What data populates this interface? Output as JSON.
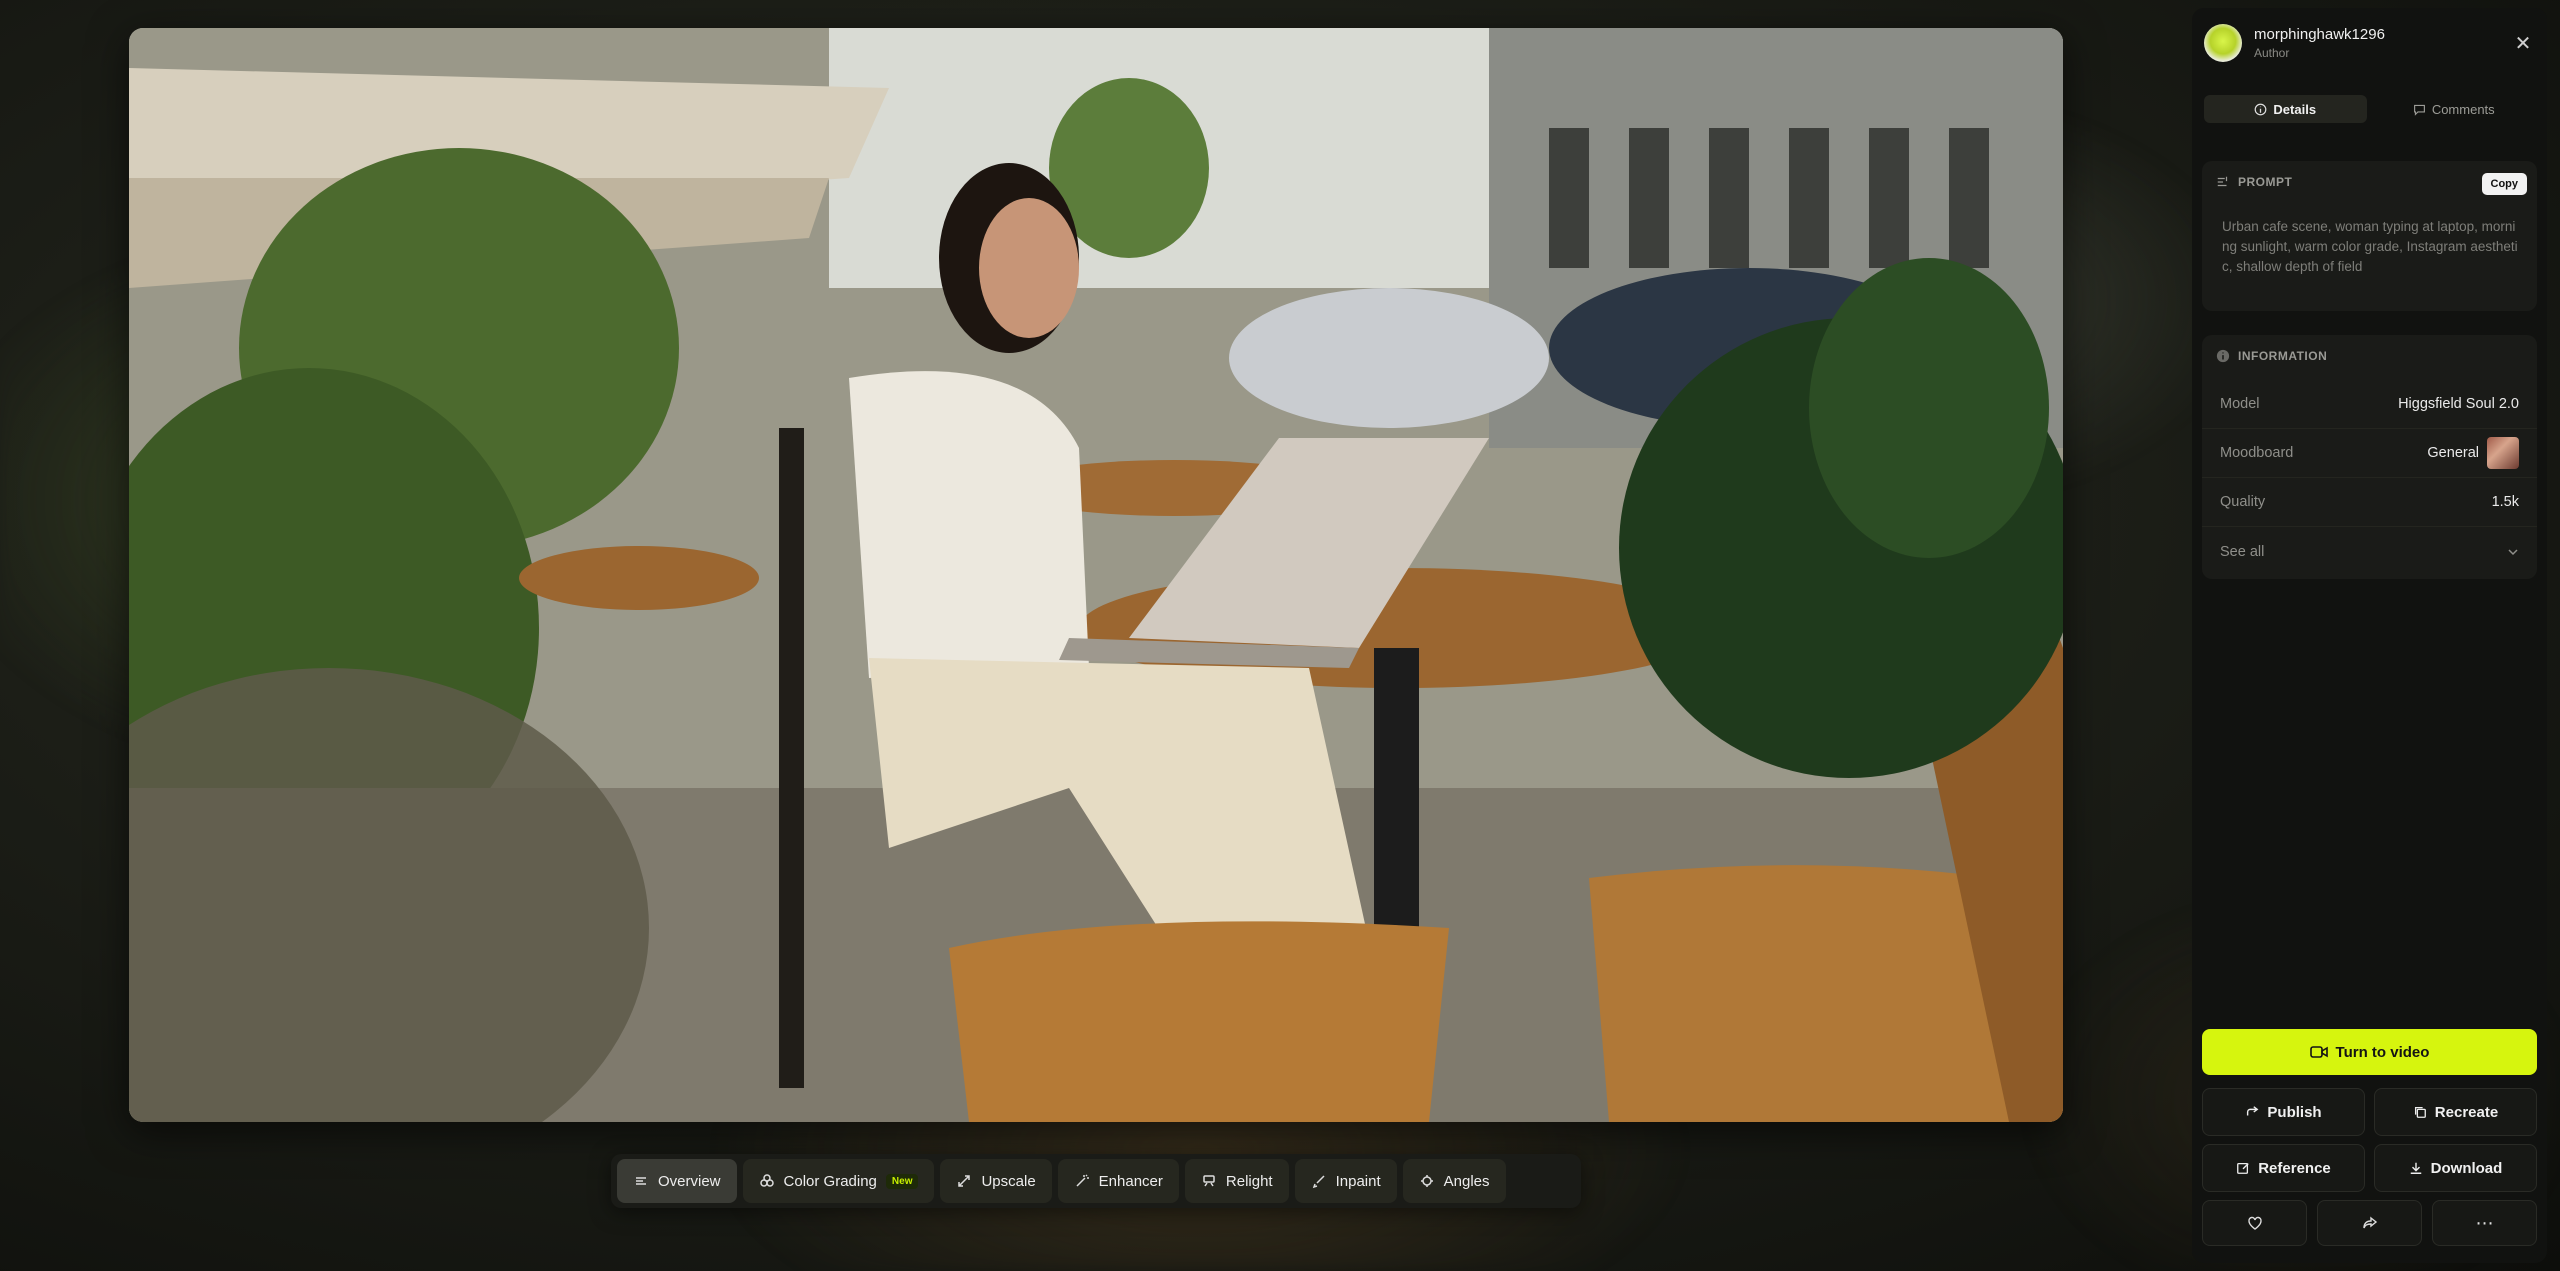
{
  "author": {
    "name": "morphinghawk1296",
    "role": "Author"
  },
  "tabs": [
    {
      "label": "Details",
      "icon": "info-icon",
      "active": true
    },
    {
      "label": "Comments",
      "icon": "comment-icon",
      "active": false
    }
  ],
  "prompt": {
    "heading": "PROMPT",
    "copy_label": "Copy",
    "text": "Urban cafe scene, woman typing at laptop, morning sunlight, warm color grade, Instagram aesthetic, shallow depth of field"
  },
  "information": {
    "heading": "INFORMATION",
    "rows": [
      {
        "key": "Model",
        "value": "Higgsfield Soul 2.0"
      },
      {
        "key": "Moodboard",
        "value": "General"
      },
      {
        "key": "Quality",
        "value": "1.5k"
      }
    ],
    "see_all": "See all"
  },
  "actions": {
    "turn_to_video": "Turn to video",
    "publish": "Publish",
    "recreate": "Recreate",
    "reference": "Reference",
    "download": "Download"
  },
  "toolbar": [
    {
      "label": "Overview",
      "icon": "overview-icon",
      "active": true
    },
    {
      "label": "Color Grading",
      "icon": "palette-icon",
      "badge": "New"
    },
    {
      "label": "Upscale",
      "icon": "expand-icon"
    },
    {
      "label": "Enhancer",
      "icon": "wand-icon"
    },
    {
      "label": "Relight",
      "icon": "light-icon"
    },
    {
      "label": "Inpaint",
      "icon": "brush-icon"
    },
    {
      "label": "Angles",
      "icon": "angles-icon"
    }
  ],
  "colors": {
    "accent": "#d6f50e",
    "panel": "#111210",
    "card": "#1a1b18"
  }
}
